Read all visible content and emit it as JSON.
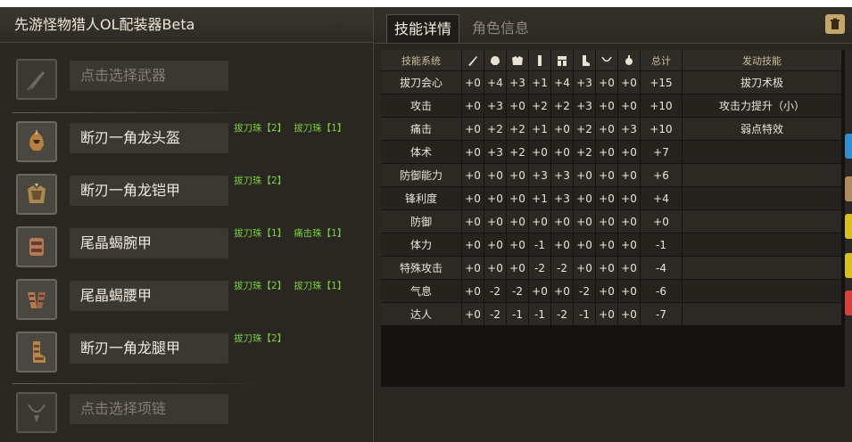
{
  "app": {
    "title": "先游怪物猎人OL配装器Beta"
  },
  "equipment": {
    "weapon": {
      "placeholder": "点击选择武器"
    },
    "armor": [
      {
        "name": "断刃一角龙头盔",
        "icon": "helmet-icon",
        "jewels": [
          "拔刀珠【2】",
          "拔刀珠【1】"
        ]
      },
      {
        "name": "断刃一角龙铠甲",
        "icon": "chest-armor-icon",
        "jewels": [
          "拔刀珠【2】"
        ]
      },
      {
        "name": "尾晶蝎腕甲",
        "icon": "gauntlet-icon",
        "jewels": [
          "拔刀珠【1】",
          "痛击珠【1】"
        ]
      },
      {
        "name": "尾晶蝎腰甲",
        "icon": "waist-armor-icon",
        "jewels": [
          "拔刀珠【2】",
          "拔刀珠【1】"
        ]
      },
      {
        "name": "断刃一角龙腿甲",
        "icon": "leg-armor-icon",
        "jewels": [
          "拔刀珠【2】"
        ]
      }
    ],
    "necklace": {
      "placeholder": "点击选择项链"
    }
  },
  "tabs": {
    "skills": "技能详情",
    "character": "角色信息"
  },
  "table": {
    "col_skill": "技能系统",
    "col_total": "总计",
    "col_active": "发动技能",
    "slot_icons": [
      "weapon-icon",
      "helmet-icon",
      "chest-armor-icon",
      "gauntlet-icon",
      "waist-armor-icon",
      "leg-armor-icon",
      "necklace-icon",
      "jewel-icon"
    ],
    "rows": [
      {
        "skill": "拔刀会心",
        "v": [
          "+0",
          "+4",
          "+3",
          "+1",
          "+4",
          "+3",
          "+0",
          "+0"
        ],
        "total": "+15",
        "active": "拔刀术极"
      },
      {
        "skill": "攻击",
        "v": [
          "+0",
          "+3",
          "+0",
          "+2",
          "+2",
          "+3",
          "+0",
          "+0"
        ],
        "total": "+10",
        "active": "攻击力提升（小）"
      },
      {
        "skill": "痛击",
        "v": [
          "+0",
          "+2",
          "+2",
          "+1",
          "+0",
          "+2",
          "+0",
          "+3"
        ],
        "total": "+10",
        "active": "弱点特效"
      },
      {
        "skill": "体术",
        "v": [
          "+0",
          "+3",
          "+2",
          "+0",
          "+0",
          "+2",
          "+0",
          "+0"
        ],
        "total": "+7",
        "active": ""
      },
      {
        "skill": "防御能力",
        "v": [
          "+0",
          "+0",
          "+0",
          "+3",
          "+3",
          "+0",
          "+0",
          "+0"
        ],
        "total": "+6",
        "active": ""
      },
      {
        "skill": "锋利度",
        "v": [
          "+0",
          "+0",
          "+0",
          "+1",
          "+3",
          "+0",
          "+0",
          "+0"
        ],
        "total": "+4",
        "active": ""
      },
      {
        "skill": "防御",
        "v": [
          "+0",
          "+0",
          "+0",
          "+0",
          "+0",
          "+0",
          "+0",
          "+0"
        ],
        "total": "+0",
        "active": ""
      },
      {
        "skill": "体力",
        "v": [
          "+0",
          "+0",
          "+0",
          "-1",
          "+0",
          "+0",
          "+0",
          "+0"
        ],
        "total": "-1",
        "active": ""
      },
      {
        "skill": "特殊攻击",
        "v": [
          "+0",
          "+0",
          "+0",
          "-2",
          "-2",
          "+0",
          "+0",
          "+0"
        ],
        "total": "-4",
        "active": ""
      },
      {
        "skill": "气息",
        "v": [
          "+0",
          "-2",
          "-2",
          "+0",
          "+0",
          "-2",
          "+0",
          "+0"
        ],
        "total": "-6",
        "active": ""
      },
      {
        "skill": "达人",
        "v": [
          "+0",
          "-2",
          "-1",
          "-1",
          "-2",
          "-1",
          "+0",
          "+0"
        ],
        "total": "-7",
        "active": ""
      }
    ]
  },
  "colors": {
    "jewel_text": "#7bd03a",
    "accent_tab": "#1f1c19",
    "trash": "#c2a66a"
  }
}
